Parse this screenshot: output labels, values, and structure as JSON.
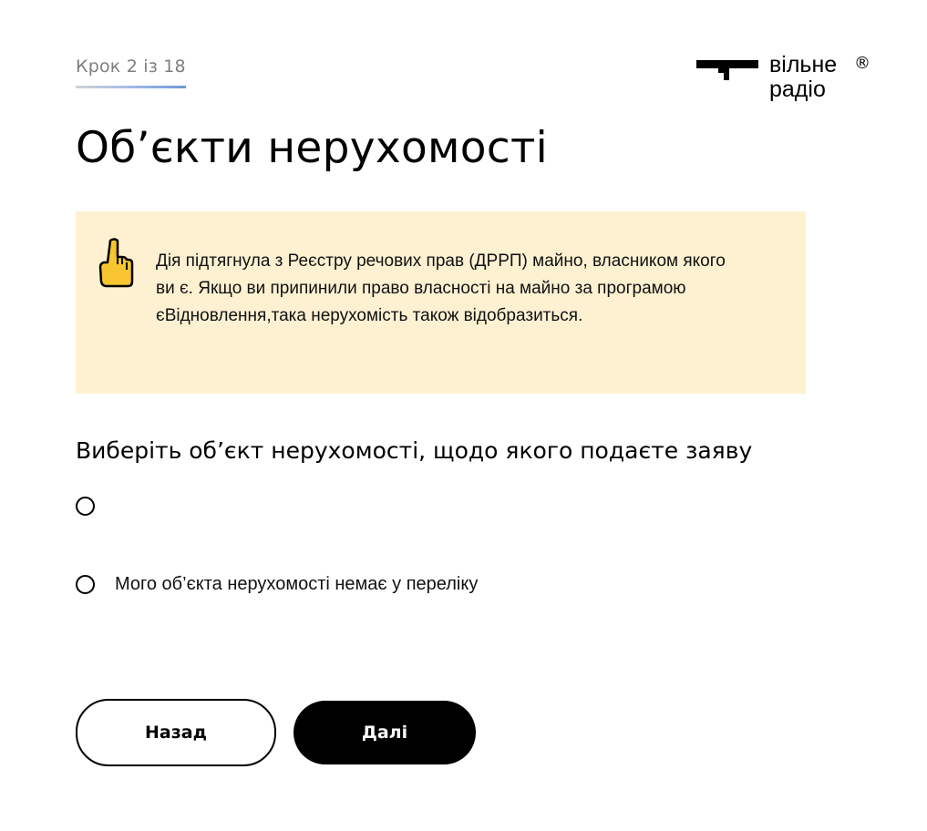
{
  "step": {
    "label": "Крок 2 із 18",
    "current": 2,
    "total": 18
  },
  "logo": {
    "line1": "вільне",
    "line2": "радіо",
    "registered": "®"
  },
  "page": {
    "title": "Об’єкти нерухомості"
  },
  "notice": {
    "icon": "pointing-up-hand-icon",
    "text": "Дія підтягнула з Реєстру речових прав (ДРРП) майно, власником якого ви є. Якщо ви припинили право власності на майно за програмою єВідновлення,така нерухомість також відобразиться."
  },
  "form": {
    "question": "Виберіть об’єкт нерухомості, щодо якого подаєте заяву",
    "options": [
      {
        "label": "",
        "selected": false
      },
      {
        "label": "Мого об’єкта нерухомості немає у переліку",
        "selected": false
      }
    ]
  },
  "buttons": {
    "back": "Назад",
    "next": "Далі"
  },
  "colors": {
    "notice_background": "#fdf1d2",
    "accent_gradient_end": "#6e98d6",
    "text": "#000000",
    "muted": "#7e7e7e"
  }
}
